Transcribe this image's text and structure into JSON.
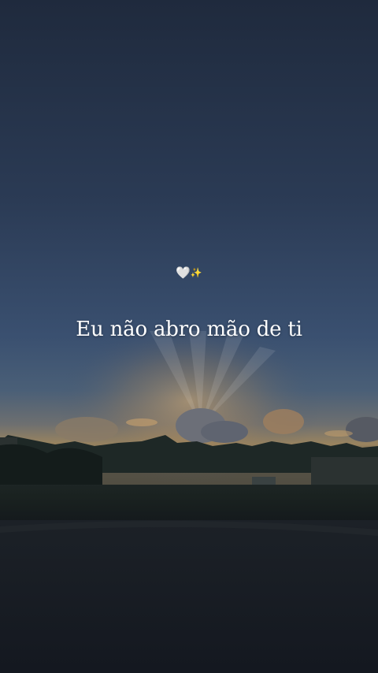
{
  "overlay": {
    "emoji_heart": "🤍",
    "emoji_sparkles": "✨",
    "caption": "Eu não abro mão de ti"
  },
  "colors": {
    "sky_top": "#1f2b3f",
    "sky_mid": "#354a67",
    "horizon_glow": "#c9a36b",
    "caption_text": "#ffffff"
  },
  "icons": [
    "white-heart-icon",
    "sparkles-icon"
  ]
}
